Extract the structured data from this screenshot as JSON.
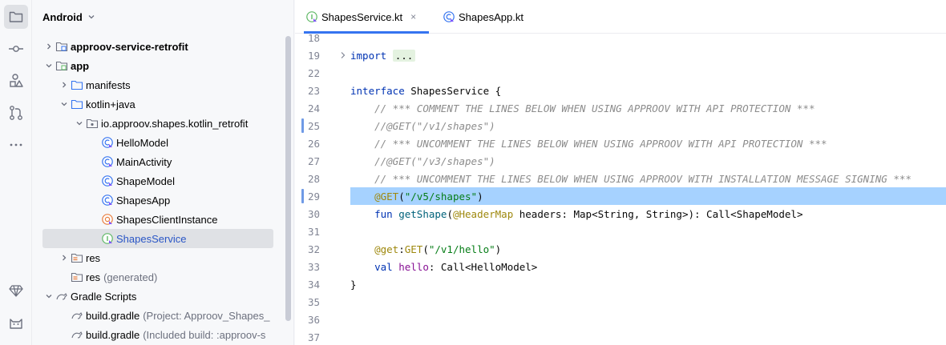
{
  "activity_bar": {
    "items": [
      {
        "icon": "folder-icon",
        "active": true
      },
      {
        "icon": "commit-icon",
        "active": false
      },
      {
        "icon": "structure-icon",
        "active": false
      },
      {
        "icon": "pull-requests-icon",
        "active": false
      },
      {
        "icon": "more-icon",
        "active": false
      },
      {
        "icon": "gem-icon",
        "active": false
      },
      {
        "icon": "cat-icon",
        "active": false
      }
    ]
  },
  "project": {
    "title": "Android",
    "tree": [
      {
        "label": "approov-service-retrofit",
        "bold": true,
        "expanded": false,
        "icon": "module-folder"
      },
      {
        "label": "app",
        "bold": true,
        "expanded": true,
        "icon": "app-module-folder"
      },
      {
        "label": "manifests",
        "expanded": false,
        "icon": "folder"
      },
      {
        "label": "kotlin+java",
        "expanded": true,
        "icon": "folder"
      },
      {
        "label": "io.approov.shapes.kotlin_retrofit",
        "expanded": true,
        "icon": "package"
      },
      {
        "label": "HelloModel",
        "icon": "kotlin-class"
      },
      {
        "label": "MainActivity",
        "icon": "kotlin-class"
      },
      {
        "label": "ShapeModel",
        "icon": "kotlin-class"
      },
      {
        "label": "ShapesApp",
        "icon": "kotlin-class"
      },
      {
        "label": "ShapesClientInstance",
        "icon": "kotlin-object"
      },
      {
        "label": "ShapesService",
        "icon": "kotlin-interface",
        "selected": true
      },
      {
        "label": "res",
        "expanded": false,
        "icon": "res-folder"
      },
      {
        "label": "res",
        "sub": "(generated)",
        "icon": "res-folder"
      },
      {
        "label": "Gradle Scripts",
        "expanded": true,
        "icon": "gradle-folder"
      },
      {
        "label": "build.gradle",
        "sub": "(Project: Approov_Shapes_",
        "icon": "gradle-file"
      },
      {
        "label": "build.gradle",
        "sub": "(Included build: :approov-s",
        "icon": "gradle-file"
      }
    ]
  },
  "tabs": [
    {
      "label": "ShapesService.kt",
      "active": true,
      "close": "×"
    },
    {
      "label": "ShapesApp.kt",
      "active": false
    }
  ],
  "code": {
    "highlighted_line": 29,
    "lines": [
      {
        "n": "18",
        "tokens": []
      },
      {
        "n": "19",
        "tokens": [
          {
            "t": "kw",
            "v": "import"
          },
          {
            "t": "",
            "v": " "
          },
          {
            "t": "fold-box",
            "v": "..."
          }
        ],
        "fold": true
      },
      {
        "n": "22",
        "tokens": []
      },
      {
        "n": "23",
        "tokens": [
          {
            "t": "kw",
            "v": "interface"
          },
          {
            "t": "",
            "v": " ShapesService {"
          }
        ]
      },
      {
        "n": "24",
        "tokens": [
          {
            "t": "",
            "v": "    "
          },
          {
            "t": "cm",
            "v": "// *** COMMENT THE LINES BELOW WHEN USING APPROOV WITH API PROTECTION ***"
          }
        ]
      },
      {
        "n": "25",
        "tokens": [
          {
            "t": "",
            "v": "    "
          },
          {
            "t": "cm",
            "v": "//@GET(\"/v1/shapes\")"
          }
        ],
        "gutter": true
      },
      {
        "n": "26",
        "tokens": [
          {
            "t": "",
            "v": "    "
          },
          {
            "t": "cm",
            "v": "// *** UNCOMMENT THE LINES BELOW WHEN USING APPROOV WITH API PROTECTION ***"
          }
        ]
      },
      {
        "n": "27",
        "tokens": [
          {
            "t": "",
            "v": "    "
          },
          {
            "t": "cm",
            "v": "//@GET(\"/v3/shapes\")"
          }
        ]
      },
      {
        "n": "28",
        "tokens": [
          {
            "t": "",
            "v": "    "
          },
          {
            "t": "cm",
            "v": "// *** UNCOMMENT THE LINES BELOW WHEN USING APPROOV WITH INSTALLATION MESSAGE SIGNING ***"
          }
        ]
      },
      {
        "n": "29",
        "tokens": [
          {
            "t": "",
            "v": "    "
          },
          {
            "t": "ann",
            "v": "@GET"
          },
          {
            "t": "",
            "v": "("
          },
          {
            "t": "str",
            "v": "\"/v5/shapes\""
          },
          {
            "t": "",
            "v": ")"
          }
        ],
        "gutter": true
      },
      {
        "n": "30",
        "tokens": [
          {
            "t": "",
            "v": "    "
          },
          {
            "t": "kw",
            "v": "fun"
          },
          {
            "t": "",
            "v": " "
          },
          {
            "t": "fn",
            "v": "getShape"
          },
          {
            "t": "",
            "v": "("
          },
          {
            "t": "ann",
            "v": "@HeaderMap"
          },
          {
            "t": "",
            "v": " headers: Map<String, String>): Call<ShapeModel>"
          }
        ]
      },
      {
        "n": "31",
        "tokens": []
      },
      {
        "n": "32",
        "tokens": [
          {
            "t": "",
            "v": "    "
          },
          {
            "t": "ann",
            "v": "@get"
          },
          {
            "t": "",
            "v": ":"
          },
          {
            "t": "ann",
            "v": "GET"
          },
          {
            "t": "",
            "v": "("
          },
          {
            "t": "str",
            "v": "\"/v1/hello\""
          },
          {
            "t": "",
            "v": ")"
          }
        ]
      },
      {
        "n": "33",
        "tokens": [
          {
            "t": "",
            "v": "    "
          },
          {
            "t": "kw",
            "v": "val"
          },
          {
            "t": "",
            "v": " "
          },
          {
            "t": "prop",
            "v": "hello"
          },
          {
            "t": "",
            "v": ": Call<HelloModel>"
          }
        ]
      },
      {
        "n": "34",
        "tokens": [
          {
            "t": "",
            "v": "}"
          }
        ]
      },
      {
        "n": "35",
        "tokens": []
      },
      {
        "n": "36",
        "tokens": []
      },
      {
        "n": "37",
        "tokens": []
      }
    ]
  }
}
